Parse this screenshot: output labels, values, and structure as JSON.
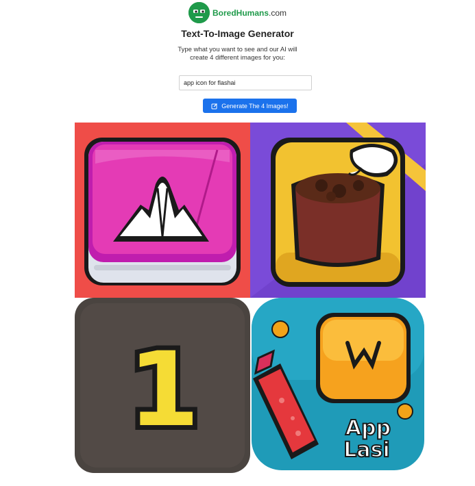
{
  "site": {
    "logo_part1": "Bored",
    "logo_part2": "Humans",
    "logo_part3": ".com"
  },
  "page": {
    "title": "Text-To-Image Generator",
    "subtitle": "Type what you want to see and our AI will\ncreate 4 different images for you:"
  },
  "form": {
    "prompt_value": "app icon for flashai",
    "generate_label": "Generate The 4 Images!"
  },
  "images": [
    {
      "subject": "pink app icon with white peaks"
    },
    {
      "subject": "yellow app icon with chocolate cup"
    },
    {
      "subject": "dark app icon with yellow number one"
    },
    {
      "subject": "blue app icon with red bottle and orange tile"
    }
  ],
  "image_texts": {
    "tile1_numeral": "1",
    "tile4_line1": "App",
    "tile4_line2": "Lasi"
  },
  "colors": {
    "brand_green": "#1f9a4a",
    "button_blue": "#1b72ec"
  }
}
